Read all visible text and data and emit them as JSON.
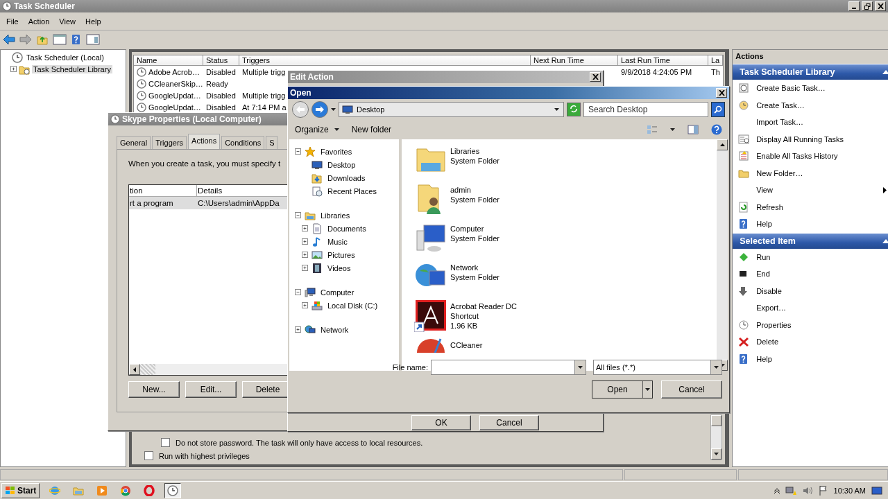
{
  "main_window": {
    "title": "Task Scheduler",
    "menu": [
      "File",
      "Action",
      "View",
      "Help"
    ],
    "tree": [
      {
        "label": "Task Scheduler (Local)",
        "kind": "clock",
        "selected": false,
        "children": [
          {
            "label": "Task Scheduler Library",
            "kind": "task-folder",
            "expanded": false,
            "selected": true
          }
        ]
      }
    ],
    "task_list": {
      "columns": [
        "Name",
        "Status",
        "Triggers",
        "Next Run Time",
        "Last Run Time",
        "La"
      ],
      "rows": [
        {
          "name": "Adobe Acrob…",
          "status": "Disabled",
          "triggers": "Multiple trigg",
          "last_run": "9/9/2018 4:24:05 PM",
          "last_col": "Th"
        },
        {
          "name": "CCleanerSkip…",
          "status": "Ready"
        },
        {
          "name": "GoogleUpdat…",
          "status": "Disabled",
          "triggers": "Multiple trigg"
        },
        {
          "name": "GoogleUpdat…",
          "status": "Disabled",
          "triggers": "At 7:14 PM a"
        }
      ]
    },
    "general_options": [
      {
        "label": "Do not store password. The task will only have access to local resources.",
        "checked": false
      },
      {
        "label": "Run with highest privileges",
        "checked": false
      }
    ],
    "actions_pane": {
      "title": "Actions",
      "sections": [
        {
          "title": "Task Scheduler Library",
          "expanded": true,
          "items": [
            {
              "label": "Create Basic Task…",
              "kind": "create-basic",
              "submenu": false
            },
            {
              "label": "Create Task…",
              "kind": "create",
              "submenu": false
            },
            {
              "label": "Import Task…",
              "kind": "none",
              "submenu": false
            },
            {
              "label": "Display All Running Tasks",
              "kind": "running",
              "submenu": false
            },
            {
              "label": "Enable All Tasks History",
              "kind": "history",
              "submenu": false
            },
            {
              "label": "New Folder…",
              "kind": "folder",
              "submenu": false
            },
            {
              "label": "View",
              "kind": "none",
              "submenu": true
            },
            {
              "label": "Refresh",
              "kind": "refresh",
              "submenu": false
            },
            {
              "label": "Help",
              "kind": "help",
              "submenu": false
            }
          ]
        },
        {
          "title": "Selected Item",
          "expanded": true,
          "items": [
            {
              "label": "Run",
              "kind": "run",
              "submenu": false
            },
            {
              "label": "End",
              "kind": "end",
              "submenu": false
            },
            {
              "label": "Disable",
              "kind": "disable",
              "submenu": false
            },
            {
              "label": "Export…",
              "kind": "none",
              "submenu": false
            },
            {
              "label": "Properties",
              "kind": "properties",
              "submenu": false
            },
            {
              "label": "Delete",
              "kind": "delete",
              "submenu": false
            },
            {
              "label": "Help",
              "kind": "help",
              "submenu": false
            }
          ]
        }
      ]
    }
  },
  "skype_properties": {
    "title": "Skype Properties (Local Computer)",
    "tabs": [
      {
        "label": "General",
        "selected": false
      },
      {
        "label": "Triggers",
        "selected": false
      },
      {
        "label": "Actions",
        "selected": true
      },
      {
        "label": "Conditions",
        "selected": false
      },
      {
        "label": "S",
        "selected": false
      }
    ],
    "description": "When you create a task, you must specify t",
    "columns": [
      "tion",
      "Details"
    ],
    "rows": [
      {
        "action": "rt a program",
        "details": "C:\\Users\\admin\\AppDa",
        "selected": true
      }
    ],
    "buttons": [
      "New...",
      "Edit...",
      "Delete"
    ]
  },
  "edit_action": {
    "title": "Edit Action",
    "buttons": [
      "OK",
      "Cancel"
    ]
  },
  "open_dialog": {
    "title": "Open",
    "location": "Desktop",
    "search_placeholder": "Search Desktop",
    "commands": [
      "Organize",
      "New folder"
    ],
    "nav": [
      {
        "label": "Favorites",
        "kind": "star",
        "expanded": true,
        "children": [
          {
            "label": "Desktop",
            "kind": "desktop"
          },
          {
            "label": "Downloads",
            "kind": "downloads"
          },
          {
            "label": "Recent Places",
            "kind": "recent"
          }
        ]
      },
      {
        "label": "Libraries",
        "kind": "library",
        "expanded": true,
        "children": [
          {
            "label": "Documents",
            "kind": "documents",
            "expanded": false
          },
          {
            "label": "Music",
            "kind": "music",
            "expanded": false
          },
          {
            "label": "Pictures",
            "kind": "pictures",
            "expanded": false
          },
          {
            "label": "Videos",
            "kind": "videos",
            "expanded": false
          }
        ]
      },
      {
        "label": "Computer",
        "kind": "computer",
        "expanded": true,
        "children": [
          {
            "label": "Local Disk (C:)",
            "kind": "disk",
            "expanded": false
          }
        ]
      },
      {
        "label": "Network",
        "kind": "network",
        "expanded": false
      }
    ],
    "files": [
      {
        "name": "Libraries",
        "type": "System Folder",
        "kind": "libraries"
      },
      {
        "name": "admin",
        "type": "System Folder",
        "kind": "user"
      },
      {
        "name": "Computer",
        "type": "System Folder",
        "kind": "computer"
      },
      {
        "name": "Network",
        "type": "System Folder",
        "kind": "network"
      },
      {
        "name": "Acrobat Reader DC",
        "type": "Shortcut",
        "size": "1.96 KB",
        "kind": "acrobat"
      },
      {
        "name": "CCleaner",
        "kind": "ccleaner"
      }
    ],
    "file_name_label": "File name:",
    "filter": "All files (*.*)",
    "buttons": [
      "Open",
      "Cancel"
    ]
  },
  "taskbar": {
    "start": "Start",
    "apps": [
      {
        "kind": "ie",
        "selected": false
      },
      {
        "kind": "explorer",
        "selected": false
      },
      {
        "kind": "media",
        "selected": false
      },
      {
        "kind": "chrome",
        "selected": false
      },
      {
        "kind": "opera",
        "selected": false
      },
      {
        "kind": "clock",
        "selected": true
      }
    ],
    "clock": "10:30 AM"
  }
}
